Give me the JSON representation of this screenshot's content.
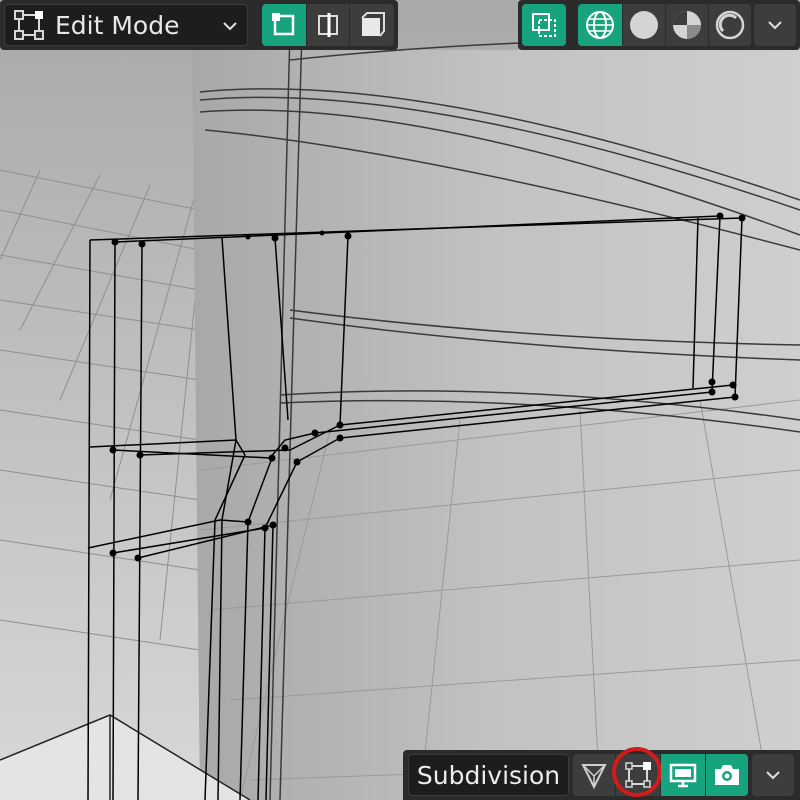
{
  "header": {
    "mode": {
      "label": "Edit Mode",
      "icon": "edit-mode-icon",
      "dropdown_icon": "chevron-down-icon"
    },
    "select_modes": [
      "vertex-select-icon",
      "edge-select-icon",
      "face-select-icon"
    ],
    "xray": {
      "icon": "xray-toggle-icon",
      "active": true
    },
    "shading_modes": [
      "wireframe-shading-icon",
      "solid-shading-icon",
      "material-preview-icon",
      "rendered-shading-icon"
    ],
    "shading_dropdown_icon": "chevron-down-icon"
  },
  "modifier_bar": {
    "name": "Subdivision",
    "toggles": [
      "on-cage-icon",
      "edit-mode-display-icon",
      "viewport-display-icon",
      "render-icon"
    ],
    "dropdown_icon": "chevron-down-icon",
    "highlighted": "edit-mode-display-icon"
  },
  "colors": {
    "accent": "#17a37e",
    "header_bg": "#2b2b2b",
    "highlight_ring": "#d11c1c",
    "wire": "#000000"
  }
}
